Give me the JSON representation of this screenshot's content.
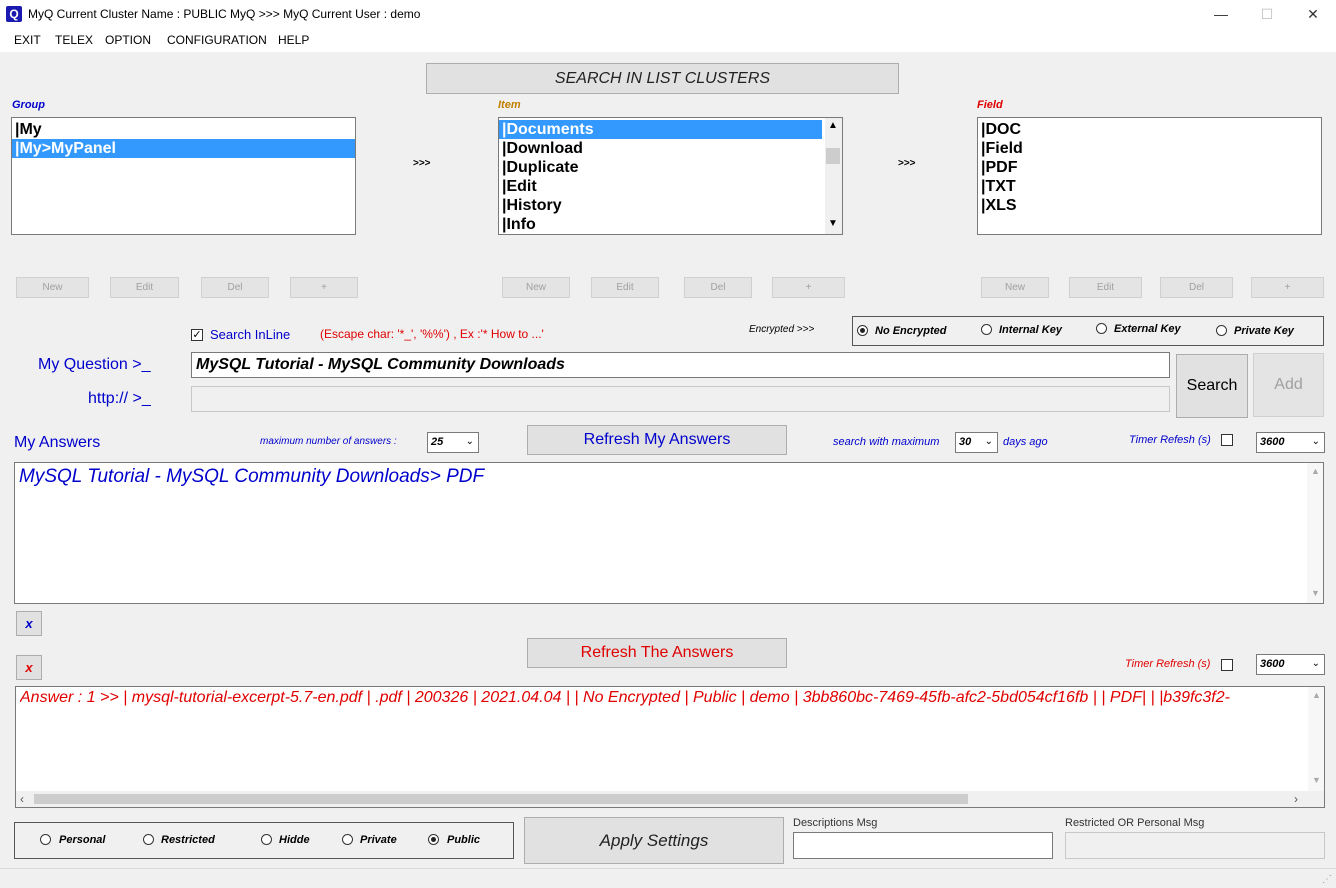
{
  "window": {
    "title": "MyQ Current Cluster Name : PUBLIC MyQ >>> MyQ Current User : demo",
    "app_icon": "Q",
    "minimize": "—",
    "maximize": "☐",
    "close": "✕"
  },
  "menu": [
    "EXIT",
    "TELEX",
    "OPTION",
    "CONFIGURATION",
    "HELP"
  ],
  "search_clusters_button": "SEARCH IN LIST CLUSTERS",
  "group": {
    "label": "Group",
    "items": [
      "|My",
      "|My>MyPanel"
    ],
    "selected": 1
  },
  "item": {
    "label": "Item",
    "items": [
      "|Documents",
      "|Download",
      "|Duplicate",
      "|Edit",
      "|History",
      "|Info"
    ],
    "selected": 0
  },
  "field": {
    "label": "Field",
    "items": [
      "|DOC",
      "|Field",
      "|PDF",
      "|TXT",
      "|XLS"
    ]
  },
  "arrows": ">>>",
  "list_buttons": [
    "New",
    "Edit",
    "Del",
    "+"
  ],
  "search_inline": {
    "label": "Search InLine",
    "checked": true
  },
  "escape_hint": "(Escape char: '*_', '%%') , Ex :'* How to ...'",
  "encrypted": {
    "label": "Encrypted >>>",
    "options": [
      "No Encrypted",
      "Internal Key",
      "External Key",
      "Private Key"
    ],
    "selected": 0
  },
  "question": {
    "label": "My Question >_",
    "value": "MySQL Tutorial - MySQL Community Downloads",
    "http_label": "http:// >_",
    "http_value": ""
  },
  "search_button": "Search",
  "add_button": "Add",
  "answers": {
    "label": "My Answers",
    "max_label": "maximum number of answers :",
    "max_value": "25",
    "refresh_button": "Refresh My Answers",
    "days_label": "search with maximum",
    "days_value": "30",
    "days_suffix": "days ago",
    "timer_label": "Timer Refesh (s)",
    "timer_value": "3600",
    "text": "MySQL Tutorial - MySQL Community Downloads> PDF",
    "clear_button": "x"
  },
  "the_answers": {
    "clear_button": "x",
    "refresh_button": "Refresh The Answers",
    "timer_label": "Timer Refresh (s)",
    "timer_value": "3600",
    "text": "Answer : 1 >> | mysql-tutorial-excerpt-5.7-en.pdf | .pdf | 200326 | 2021.04.04 |  | No Encrypted | Public | demo | 3bb860bc-7469-45fb-afc2-5bd054cf16fb |  | PDF|   | |b39fc3f2-"
  },
  "visibility": {
    "options": [
      "Personal",
      "Restricted",
      "Hidde",
      "Private",
      "Public"
    ],
    "selected": 4
  },
  "apply_button": "Apply Settings",
  "descriptions": {
    "label": "Descriptions Msg",
    "value": ""
  },
  "restricted": {
    "label": "Restricted OR Personal Msg",
    "value": ""
  }
}
